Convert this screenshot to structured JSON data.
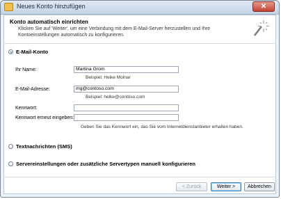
{
  "window": {
    "title": "Neues Konto hinzufügen",
    "close_label": "✕"
  },
  "header": {
    "title": "Konto automatisch einrichten",
    "description": "Klicken Sie auf 'Weiter', um eine Verbindung mit dem E-Mail-Server herzustellen und Ihre Kontoeinstellungen automatisch zu konfigurieren."
  },
  "options": {
    "email_account": "E-Mail-Konto",
    "sms": "Textnachrichten (SMS)",
    "manual": "Servereinstellungen oder zusätzliche Servertypen manuell konfigurieren"
  },
  "form": {
    "name_label": "Ihr Name:",
    "name_value": "Martina Grom",
    "name_example": "Beispiel: Heike Molnar",
    "email_label": "E-Mail-Adresse:",
    "email_value": "mg@contoso.com",
    "email_example": "Beispiel: heike@contoso.com",
    "password_label": "Kennwort:",
    "password_value": "",
    "password_repeat_label": "Kennwort erneut eingeben:",
    "password_repeat_value": "",
    "password_hint": "Geben Sie das Kennwort ein, das Sie vom Internetdienstanbieter erhalten haben."
  },
  "buttons": {
    "back": "< Zurück",
    "next": "Weiter >",
    "cancel": "Abbrechen"
  }
}
